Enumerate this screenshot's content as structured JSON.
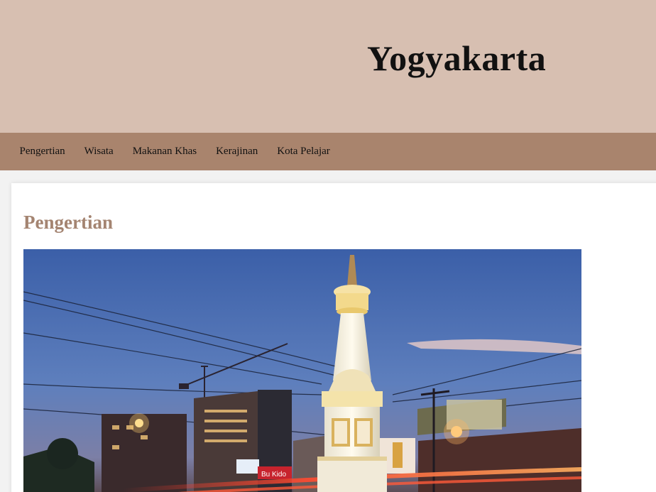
{
  "header": {
    "site_title": "Yogyakarta"
  },
  "nav": {
    "items": [
      "Pengertian",
      "Wisata",
      "Makanan Khas",
      "Kerajinan",
      "Kota Pelajar"
    ]
  },
  "main": {
    "section_title": "Pengertian",
    "photo": {
      "signs": [
        "Bu Kido"
      ]
    }
  },
  "colors": {
    "header_bg": "#d7bfb1",
    "nav_bg": "#a9846d",
    "section_title": "#a48471",
    "page_bg": "#f2f2f2",
    "card_bg": "#ffffff"
  }
}
